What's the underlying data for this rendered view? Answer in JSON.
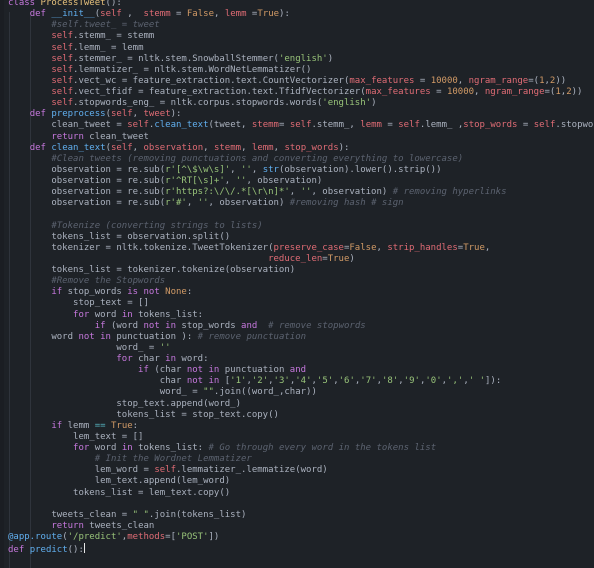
{
  "editor": {
    "theme_colors": {
      "background": "#1e2227",
      "keyword": "#c678dd",
      "function": "#61afef",
      "class": "#e5c07b",
      "self": "#e06c75",
      "string": "#98c379",
      "number": "#d19a66",
      "comment": "#5c6370",
      "operator": "#56b6c2"
    },
    "lines": [
      [
        [
          "kw",
          "class "
        ],
        [
          "cls",
          "ProcessTweet"
        ],
        [
          "",
          "():"
        ]
      ],
      [
        [
          "",
          "    "
        ],
        [
          "kw",
          "def "
        ],
        [
          "fn",
          "__init__"
        ],
        [
          "",
          "("
        ],
        [
          "self",
          "self"
        ],
        [
          "",
          " ,  "
        ],
        [
          "pm",
          "stemm"
        ],
        [
          "",
          " = "
        ],
        [
          "num",
          "False"
        ],
        [
          "",
          ", "
        ],
        [
          "pm",
          "lemm"
        ],
        [
          "",
          " ="
        ],
        [
          "num",
          "True"
        ],
        [
          "",
          "):"
        ]
      ],
      [
        [
          "cm",
          "        #self.tweet_ = tweet"
        ]
      ],
      [
        [
          "",
          "        "
        ],
        [
          "self",
          "self"
        ],
        [
          "",
          ".stemm_ = stemm"
        ]
      ],
      [
        [
          "",
          "        "
        ],
        [
          "self",
          "self"
        ],
        [
          "",
          ".lemm_ = lemm"
        ]
      ],
      [
        [
          "",
          "        "
        ],
        [
          "self",
          "self"
        ],
        [
          "",
          ".stemmer_ = nltk.stem.SnowballStemmer("
        ],
        [
          "str",
          "'english'"
        ],
        [
          "",
          ")"
        ]
      ],
      [
        [
          "",
          "        "
        ],
        [
          "self",
          "self"
        ],
        [
          "",
          ".lemmatizer_ = nltk.stem.WordNetLemmatizer()"
        ]
      ],
      [
        [
          "",
          "        "
        ],
        [
          "self",
          "self"
        ],
        [
          "",
          ".vect_wc = feature_extraction.text.CountVectorizer("
        ],
        [
          "pm",
          "max_features"
        ],
        [
          "",
          " = "
        ],
        [
          "num",
          "10000"
        ],
        [
          "",
          ", "
        ],
        [
          "pm",
          "ngram_range"
        ],
        [
          "",
          "=("
        ],
        [
          "num",
          "1"
        ],
        [
          "",
          ","
        ],
        [
          "num",
          "2"
        ],
        [
          "",
          "))"
        ]
      ],
      [
        [
          "",
          "        "
        ],
        [
          "self",
          "self"
        ],
        [
          "",
          ".vect_tfidf = feature_extraction.text.TfidfVectorizer("
        ],
        [
          "pm",
          "max_features"
        ],
        [
          "",
          " = "
        ],
        [
          "num",
          "10000"
        ],
        [
          "",
          ", "
        ],
        [
          "pm",
          "ngram_range"
        ],
        [
          "",
          "=("
        ],
        [
          "num",
          "1"
        ],
        [
          "",
          ","
        ],
        [
          "num",
          "2"
        ],
        [
          "",
          "))"
        ]
      ],
      [
        [
          "",
          "        "
        ],
        [
          "self",
          "self"
        ],
        [
          "",
          ".stopwords_eng_ = nltk.corpus.stopwords.words("
        ],
        [
          "str",
          "'english'"
        ],
        [
          "",
          ")"
        ]
      ],
      [
        [
          "",
          "    "
        ],
        [
          "kw",
          "def "
        ],
        [
          "fn",
          "preprocess"
        ],
        [
          "",
          "("
        ],
        [
          "self",
          "self"
        ],
        [
          "",
          ", "
        ],
        [
          "pm",
          "tweet"
        ],
        [
          "",
          "):"
        ]
      ],
      [
        [
          "",
          "        clean_tweet = "
        ],
        [
          "self",
          "self"
        ],
        [
          "",
          "."
        ],
        [
          "fn",
          "clean_text"
        ],
        [
          "",
          "(tweet, "
        ],
        [
          "pm",
          "stemm"
        ],
        [
          "",
          "= "
        ],
        [
          "self",
          "self"
        ],
        [
          "",
          ".stemm_, "
        ],
        [
          "pm",
          "lemm"
        ],
        [
          "",
          " = "
        ],
        [
          "self",
          "self"
        ],
        [
          "",
          ".lemm_ ,"
        ],
        [
          "pm",
          "stop_words"
        ],
        [
          "",
          " = "
        ],
        [
          "self",
          "self"
        ],
        [
          "",
          ".stopwords_eng_)"
        ]
      ],
      [
        [
          "",
          "        "
        ],
        [
          "kw",
          "return "
        ],
        [
          "",
          "clean_tweet"
        ]
      ],
      [
        [
          "",
          "    "
        ],
        [
          "kw",
          "def "
        ],
        [
          "fn",
          "clean_text"
        ],
        [
          "",
          "("
        ],
        [
          "self",
          "self"
        ],
        [
          "",
          ", "
        ],
        [
          "pm",
          "observation"
        ],
        [
          "",
          ", "
        ],
        [
          "pm",
          "stemm"
        ],
        [
          "",
          ", "
        ],
        [
          "pm",
          "lemm"
        ],
        [
          "",
          ", "
        ],
        [
          "pm",
          "stop_words"
        ],
        [
          "",
          "):"
        ]
      ],
      [
        [
          "cm",
          "        #Clean tweets (removing punctuations and converting everything to lowercase)"
        ]
      ],
      [
        [
          "",
          "        observation = re.sub("
        ],
        [
          "str",
          "r'[^\\$\\w\\s]'"
        ],
        [
          "",
          ", "
        ],
        [
          "str",
          "''"
        ],
        [
          "",
          ", "
        ],
        [
          "fn",
          "str"
        ],
        [
          "",
          "(observation).lower().strip())"
        ]
      ],
      [
        [
          "",
          "        observation = re.sub("
        ],
        [
          "str",
          "r'^RT[\\s]+'"
        ],
        [
          "",
          ", "
        ],
        [
          "str",
          "''"
        ],
        [
          "",
          ", observation)"
        ]
      ],
      [
        [
          "",
          "        observation = re.sub("
        ],
        [
          "str",
          "r'https?:\\/\\/.*[\\r\\n]*'"
        ],
        [
          "",
          ", "
        ],
        [
          "str",
          "''"
        ],
        [
          "",
          ", observation) "
        ],
        [
          "cm",
          "# removing hyperlinks"
        ]
      ],
      [
        [
          "",
          "        observation = re.sub("
        ],
        [
          "str",
          "r'#'"
        ],
        [
          "",
          ", "
        ],
        [
          "str",
          "''"
        ],
        [
          "",
          ", observation) "
        ],
        [
          "cm",
          "#removing hash # sign"
        ]
      ],
      [
        [
          "",
          ""
        ]
      ],
      [
        [
          "cm",
          "        #Tokenize (converting strings to lists)"
        ]
      ],
      [
        [
          "",
          "        tokens_list = observation.split()"
        ]
      ],
      [
        [
          "",
          "        tokenizer = nltk.tokenize.TweetTokenizer("
        ],
        [
          "pm",
          "preserve_case"
        ],
        [
          "",
          "="
        ],
        [
          "num",
          "False"
        ],
        [
          "",
          ", "
        ],
        [
          "pm",
          "strip_handles"
        ],
        [
          "",
          "="
        ],
        [
          "num",
          "True"
        ],
        [
          "",
          ","
        ]
      ],
      [
        [
          "",
          "                                                "
        ],
        [
          "pm",
          "reduce_len"
        ],
        [
          "",
          "="
        ],
        [
          "num",
          "True"
        ],
        [
          "",
          ")"
        ]
      ],
      [
        [
          "",
          "        tokens_list = tokenizer.tokenize(observation)"
        ]
      ],
      [
        [
          "cm",
          "        #Remove the Stopwords"
        ]
      ],
      [
        [
          "",
          "        "
        ],
        [
          "kw",
          "if "
        ],
        [
          "",
          "stop_words "
        ],
        [
          "kw",
          "is not "
        ],
        [
          "num",
          "None"
        ],
        [
          "",
          ":"
        ]
      ],
      [
        [
          "",
          "            stop_text = []"
        ]
      ],
      [
        [
          "",
          "            "
        ],
        [
          "kw",
          "for "
        ],
        [
          "",
          "word "
        ],
        [
          "kw",
          "in "
        ],
        [
          "",
          "tokens_list:"
        ]
      ],
      [
        [
          "",
          "                "
        ],
        [
          "kw",
          "if "
        ],
        [
          "",
          "(word "
        ],
        [
          "kw",
          "not in "
        ],
        [
          "",
          "stop_words "
        ],
        [
          "kw",
          "and "
        ],
        [
          "cm",
          " # remove stopwords"
        ]
      ],
      [
        [
          "",
          "        word "
        ],
        [
          "kw",
          "not in "
        ],
        [
          "",
          "punctuation ): "
        ],
        [
          "cm",
          "# remove punctuation"
        ]
      ],
      [
        [
          "",
          "                    word_ = "
        ],
        [
          "str",
          "''"
        ]
      ],
      [
        [
          "",
          "                    "
        ],
        [
          "kw",
          "for "
        ],
        [
          "",
          "char "
        ],
        [
          "kw",
          "in "
        ],
        [
          "",
          "word:"
        ]
      ],
      [
        [
          "",
          "                        "
        ],
        [
          "kw",
          "if "
        ],
        [
          "",
          "(char "
        ],
        [
          "kw",
          "not in "
        ],
        [
          "",
          "punctuation "
        ],
        [
          "kw",
          "and"
        ]
      ],
      [
        [
          "",
          "                            char "
        ],
        [
          "kw",
          "not in "
        ],
        [
          "",
          "["
        ],
        [
          "str",
          "'1'"
        ],
        [
          "",
          ","
        ],
        [
          "str",
          "'2'"
        ],
        [
          "",
          ","
        ],
        [
          "str",
          "'3'"
        ],
        [
          "",
          ","
        ],
        [
          "str",
          "'4'"
        ],
        [
          "",
          ","
        ],
        [
          "str",
          "'5'"
        ],
        [
          "",
          ","
        ],
        [
          "str",
          "'6'"
        ],
        [
          "",
          ","
        ],
        [
          "str",
          "'7'"
        ],
        [
          "",
          ","
        ],
        [
          "str",
          "'8'"
        ],
        [
          "",
          ","
        ],
        [
          "str",
          "'9'"
        ],
        [
          "",
          ","
        ],
        [
          "str",
          "'0'"
        ],
        [
          "",
          ","
        ],
        [
          "str",
          "','"
        ],
        [
          "",
          ","
        ],
        [
          "str",
          "' '"
        ],
        [
          "",
          "]):"
        ]
      ],
      [
        [
          "",
          "                            word_ = "
        ],
        [
          "str",
          "\"\""
        ],
        [
          "",
          ".join((word_,char))"
        ]
      ],
      [
        [
          "",
          "                    stop_text.append(word_)"
        ]
      ],
      [
        [
          "",
          "                    tokens_list = stop_text.copy()"
        ]
      ],
      [
        [
          "",
          "        "
        ],
        [
          "kw",
          "if "
        ],
        [
          "",
          "lemm "
        ],
        [
          "op",
          "=="
        ],
        [
          "",
          " "
        ],
        [
          "num",
          "True"
        ],
        [
          "",
          ":"
        ]
      ],
      [
        [
          "",
          "            lem_text = []"
        ]
      ],
      [
        [
          "",
          "            "
        ],
        [
          "kw",
          "for "
        ],
        [
          "",
          "word "
        ],
        [
          "kw",
          "in "
        ],
        [
          "",
          "tokens_list: "
        ],
        [
          "cm",
          "# Go through every word in the tokens list"
        ]
      ],
      [
        [
          "cm",
          "                # Init the Wordnet Lemmatizer"
        ]
      ],
      [
        [
          "",
          "                lem_word = "
        ],
        [
          "self",
          "self"
        ],
        [
          "",
          ".lemmatizer_.lemmatize(word)"
        ]
      ],
      [
        [
          "",
          "                lem_text.append(lem_word)"
        ]
      ],
      [
        [
          "",
          "            tokens_list = lem_text.copy()"
        ]
      ],
      [
        [
          "",
          ""
        ]
      ],
      [
        [
          "",
          "        tweets_clean = "
        ],
        [
          "str",
          "\" \""
        ],
        [
          "",
          ".join(tokens_list)"
        ]
      ],
      [
        [
          "",
          "        "
        ],
        [
          "kw",
          "return "
        ],
        [
          "",
          "tweets_clean"
        ]
      ],
      [
        [
          "dec",
          "@app.route"
        ],
        [
          "",
          "("
        ],
        [
          "str",
          "'/predict'"
        ],
        [
          "",
          ","
        ],
        [
          "pm",
          "methods"
        ],
        [
          "",
          "=["
        ],
        [
          "str",
          "'POST'"
        ],
        [
          "",
          "])"
        ]
      ],
      [
        [
          "kw",
          "def "
        ],
        [
          "fn",
          "predict"
        ],
        [
          "",
          "():"
        ]
      ]
    ]
  }
}
